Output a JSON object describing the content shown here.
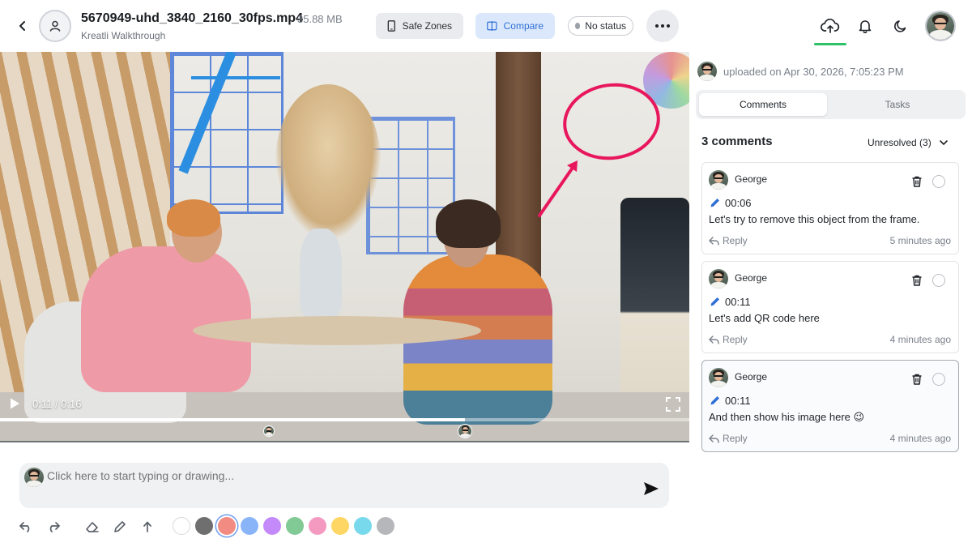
{
  "header": {
    "file_name": "5670949-uhd_3840_2160_30fps.mp4",
    "file_size": "35.88 MB",
    "project_name": "Kreatli Walkthrough",
    "safe_zones_label": "Safe Zones",
    "compare_label": "Compare",
    "status_label": "No status",
    "icons": {
      "back": "chevron-left-icon",
      "project": "user-icon",
      "safe_zones": "phone-frame-icon",
      "compare": "split-view-icon",
      "more": "ellipsis-icon",
      "upload": "cloud-upload-icon",
      "notifications": "bell-icon",
      "theme": "moon-icon"
    },
    "colors": {
      "compare_bg": "#dbe8fb",
      "compare_text": "#2f6fd6",
      "upload_indicator": "#2ec16a"
    }
  },
  "player": {
    "current_time": "0:11",
    "separator": "/",
    "duration": "0:16",
    "progress": 0.675,
    "annotation_color": "#e8175d",
    "markers": [
      {
        "author": "George",
        "time": "00:06",
        "progress": 0.39
      },
      {
        "author": "George",
        "time": "00:11",
        "progress": 0.675
      }
    ]
  },
  "composer": {
    "placeholder": "Click here to start typing or drawing..."
  },
  "toolbar": {
    "tools": [
      "undo-icon",
      "redo-icon",
      "eraser-icon",
      "pen-icon",
      "arrow-up-icon"
    ],
    "colors": [
      "#ffffff",
      "#6f6f6f",
      "#f28b82",
      "#8ab4f8",
      "#c58af9",
      "#81c995",
      "#f49ac1",
      "#fdd663",
      "#78d9ec",
      "#b5b7ba"
    ],
    "selected_color": "#f28b82"
  },
  "panel": {
    "uploaded_text": "uploaded on Apr 30, 2026, 7:05:23 PM",
    "tabs": [
      {
        "label": "Comments",
        "active": true
      },
      {
        "label": "Tasks",
        "active": false
      }
    ],
    "comment_count": "3 comments",
    "filter_label": "Unresolved (3)",
    "reply_label": "Reply",
    "comments": [
      {
        "author": "George",
        "timecode": "00:06",
        "text": "Let's try to remove this object from the frame.",
        "ago": "5 minutes ago"
      },
      {
        "author": "George",
        "timecode": "00:11",
        "text": "Let's add QR code here",
        "ago": "4 minutes ago"
      },
      {
        "author": "George",
        "timecode": "00:11",
        "text": "And then show his image here 😉",
        "ago": "4 minutes ago"
      }
    ]
  }
}
